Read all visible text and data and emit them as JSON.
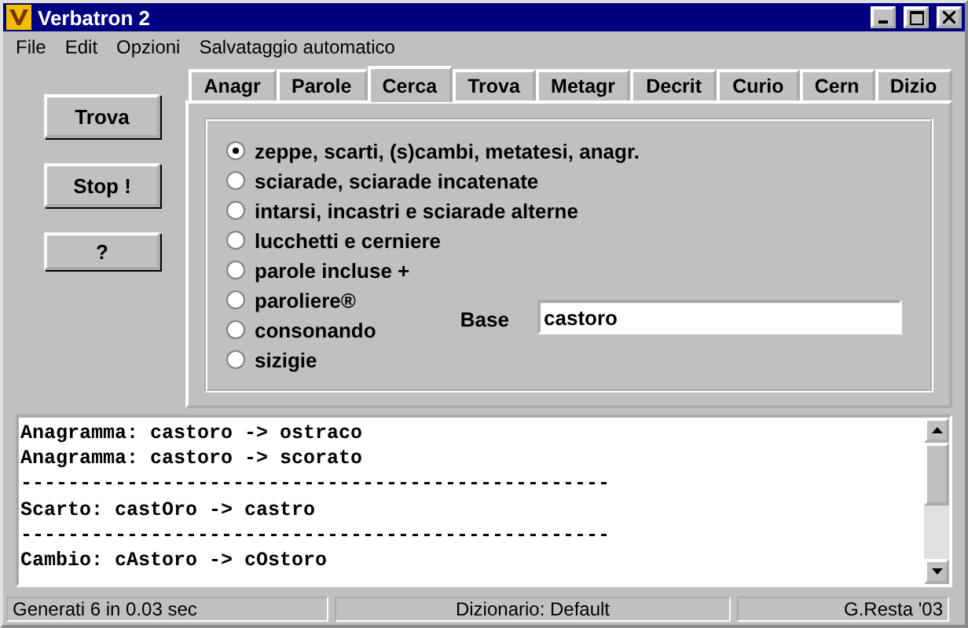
{
  "window": {
    "title": "Verbatron 2"
  },
  "menu": [
    "File",
    "Edit",
    "Opzioni",
    "Salvataggio automatico"
  ],
  "buttons": [
    "Trova",
    "Stop !",
    "?"
  ],
  "tabs": [
    {
      "label": "Anagr",
      "selected": false
    },
    {
      "label": "Parole",
      "selected": false
    },
    {
      "label": "Cerca",
      "selected": true
    },
    {
      "label": "Trova",
      "selected": false
    },
    {
      "label": "Metagr",
      "selected": false
    },
    {
      "label": "Decrit",
      "selected": false
    },
    {
      "label": "Curio",
      "selected": false
    },
    {
      "label": "Cern",
      "selected": false
    },
    {
      "label": "Dizio",
      "selected": false
    }
  ],
  "options": [
    {
      "label": "zeppe, scarti, (s)cambi, metatesi, anagr.",
      "selected": true
    },
    {
      "label": "sciarade, sciarade incatenate",
      "selected": false
    },
    {
      "label": "intarsi, incastri e sciarade alterne",
      "selected": false
    },
    {
      "label": "lucchetti e cerniere",
      "selected": false
    },
    {
      "label": "parole incluse +",
      "selected": false
    },
    {
      "label": "paroliere®",
      "selected": false
    },
    {
      "label": "consonando",
      "selected": false
    },
    {
      "label": "sizigie",
      "selected": false
    }
  ],
  "base": {
    "label": "Base",
    "value": "castoro"
  },
  "output": [
    "Anagramma: castoro -> ostraco",
    "Anagramma: castoro -> scorato",
    "--------------------------------------------------",
    "Scarto: castOro -> castro",
    "--------------------------------------------------",
    "Cambio: cAstoro -> cOstoro"
  ],
  "status_bar": [
    "Generati 6 in 0.03 sec",
    "Dizionario: Default",
    "G.Resta '03"
  ]
}
